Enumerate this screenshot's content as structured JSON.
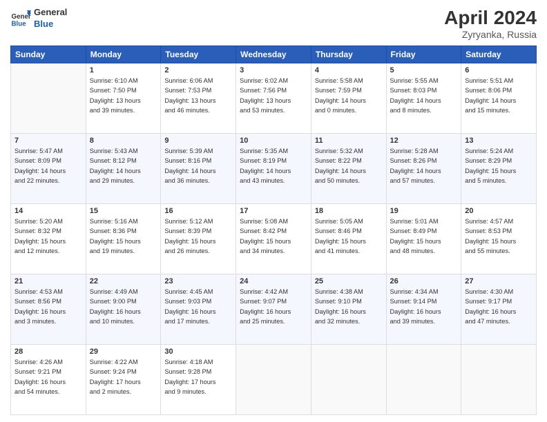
{
  "header": {
    "logo_general": "General",
    "logo_blue": "Blue",
    "title": "April 2024",
    "subtitle": "Zyryanka, Russia"
  },
  "days_of_week": [
    "Sunday",
    "Monday",
    "Tuesday",
    "Wednesday",
    "Thursday",
    "Friday",
    "Saturday"
  ],
  "weeks": [
    [
      {
        "day": "",
        "info": ""
      },
      {
        "day": "1",
        "info": "Sunrise: 6:10 AM\nSunset: 7:50 PM\nDaylight: 13 hours\nand 39 minutes."
      },
      {
        "day": "2",
        "info": "Sunrise: 6:06 AM\nSunset: 7:53 PM\nDaylight: 13 hours\nand 46 minutes."
      },
      {
        "day": "3",
        "info": "Sunrise: 6:02 AM\nSunset: 7:56 PM\nDaylight: 13 hours\nand 53 minutes."
      },
      {
        "day": "4",
        "info": "Sunrise: 5:58 AM\nSunset: 7:59 PM\nDaylight: 14 hours\nand 0 minutes."
      },
      {
        "day": "5",
        "info": "Sunrise: 5:55 AM\nSunset: 8:03 PM\nDaylight: 14 hours\nand 8 minutes."
      },
      {
        "day": "6",
        "info": "Sunrise: 5:51 AM\nSunset: 8:06 PM\nDaylight: 14 hours\nand 15 minutes."
      }
    ],
    [
      {
        "day": "7",
        "info": "Sunrise: 5:47 AM\nSunset: 8:09 PM\nDaylight: 14 hours\nand 22 minutes."
      },
      {
        "day": "8",
        "info": "Sunrise: 5:43 AM\nSunset: 8:12 PM\nDaylight: 14 hours\nand 29 minutes."
      },
      {
        "day": "9",
        "info": "Sunrise: 5:39 AM\nSunset: 8:16 PM\nDaylight: 14 hours\nand 36 minutes."
      },
      {
        "day": "10",
        "info": "Sunrise: 5:35 AM\nSunset: 8:19 PM\nDaylight: 14 hours\nand 43 minutes."
      },
      {
        "day": "11",
        "info": "Sunrise: 5:32 AM\nSunset: 8:22 PM\nDaylight: 14 hours\nand 50 minutes."
      },
      {
        "day": "12",
        "info": "Sunrise: 5:28 AM\nSunset: 8:26 PM\nDaylight: 14 hours\nand 57 minutes."
      },
      {
        "day": "13",
        "info": "Sunrise: 5:24 AM\nSunset: 8:29 PM\nDaylight: 15 hours\nand 5 minutes."
      }
    ],
    [
      {
        "day": "14",
        "info": "Sunrise: 5:20 AM\nSunset: 8:32 PM\nDaylight: 15 hours\nand 12 minutes."
      },
      {
        "day": "15",
        "info": "Sunrise: 5:16 AM\nSunset: 8:36 PM\nDaylight: 15 hours\nand 19 minutes."
      },
      {
        "day": "16",
        "info": "Sunrise: 5:12 AM\nSunset: 8:39 PM\nDaylight: 15 hours\nand 26 minutes."
      },
      {
        "day": "17",
        "info": "Sunrise: 5:08 AM\nSunset: 8:42 PM\nDaylight: 15 hours\nand 34 minutes."
      },
      {
        "day": "18",
        "info": "Sunrise: 5:05 AM\nSunset: 8:46 PM\nDaylight: 15 hours\nand 41 minutes."
      },
      {
        "day": "19",
        "info": "Sunrise: 5:01 AM\nSunset: 8:49 PM\nDaylight: 15 hours\nand 48 minutes."
      },
      {
        "day": "20",
        "info": "Sunrise: 4:57 AM\nSunset: 8:53 PM\nDaylight: 15 hours\nand 55 minutes."
      }
    ],
    [
      {
        "day": "21",
        "info": "Sunrise: 4:53 AM\nSunset: 8:56 PM\nDaylight: 16 hours\nand 3 minutes."
      },
      {
        "day": "22",
        "info": "Sunrise: 4:49 AM\nSunset: 9:00 PM\nDaylight: 16 hours\nand 10 minutes."
      },
      {
        "day": "23",
        "info": "Sunrise: 4:45 AM\nSunset: 9:03 PM\nDaylight: 16 hours\nand 17 minutes."
      },
      {
        "day": "24",
        "info": "Sunrise: 4:42 AM\nSunset: 9:07 PM\nDaylight: 16 hours\nand 25 minutes."
      },
      {
        "day": "25",
        "info": "Sunrise: 4:38 AM\nSunset: 9:10 PM\nDaylight: 16 hours\nand 32 minutes."
      },
      {
        "day": "26",
        "info": "Sunrise: 4:34 AM\nSunset: 9:14 PM\nDaylight: 16 hours\nand 39 minutes."
      },
      {
        "day": "27",
        "info": "Sunrise: 4:30 AM\nSunset: 9:17 PM\nDaylight: 16 hours\nand 47 minutes."
      }
    ],
    [
      {
        "day": "28",
        "info": "Sunrise: 4:26 AM\nSunset: 9:21 PM\nDaylight: 16 hours\nand 54 minutes."
      },
      {
        "day": "29",
        "info": "Sunrise: 4:22 AM\nSunset: 9:24 PM\nDaylight: 17 hours\nand 2 minutes."
      },
      {
        "day": "30",
        "info": "Sunrise: 4:18 AM\nSunset: 9:28 PM\nDaylight: 17 hours\nand 9 minutes."
      },
      {
        "day": "",
        "info": ""
      },
      {
        "day": "",
        "info": ""
      },
      {
        "day": "",
        "info": ""
      },
      {
        "day": "",
        "info": ""
      }
    ]
  ]
}
